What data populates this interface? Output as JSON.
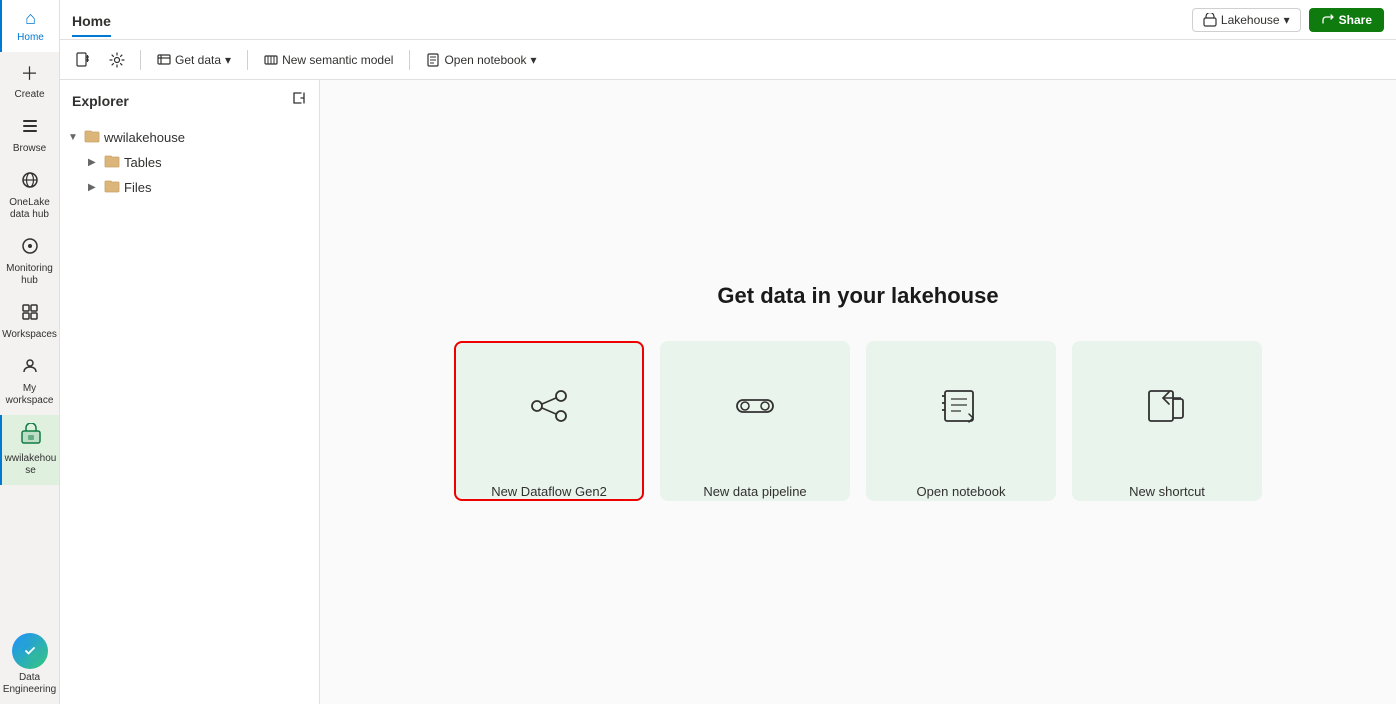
{
  "topbar": {
    "title": "Home",
    "lakehouse_btn": "Lakehouse",
    "share_btn": "Share"
  },
  "toolbar": {
    "new_item_icon": "📄",
    "settings_icon": "⚙",
    "get_data_label": "Get data",
    "new_semantic_model_label": "New semantic model",
    "open_notebook_label": "Open notebook"
  },
  "explorer": {
    "title": "Explorer",
    "root_item": "wwilakehouse",
    "children": [
      {
        "label": "Tables",
        "type": "folder"
      },
      {
        "label": "Files",
        "type": "folder"
      }
    ]
  },
  "sidebar": {
    "items": [
      {
        "id": "home",
        "label": "Home",
        "icon": "🏠",
        "active": true
      },
      {
        "id": "create",
        "label": "Create",
        "icon": "➕"
      },
      {
        "id": "browse",
        "label": "Browse",
        "icon": "📁"
      },
      {
        "id": "onelake",
        "label": "OneLake\ndata hub",
        "icon": "🌐"
      },
      {
        "id": "monitoring",
        "label": "Monitoring\nhub",
        "icon": "⊙"
      },
      {
        "id": "workspaces",
        "label": "Workspaces",
        "icon": "⊞"
      },
      {
        "id": "myworkspace",
        "label": "My\nworkspace",
        "icon": "👤"
      },
      {
        "id": "wwilakehouse",
        "label": "wwilakehou\nse",
        "icon": "💧",
        "highlight": true
      }
    ]
  },
  "main": {
    "heading": "Get data in your lakehouse",
    "cards": [
      {
        "id": "dataflow",
        "label": "New Dataflow Gen2",
        "selected": true
      },
      {
        "id": "pipeline",
        "label": "New data pipeline",
        "selected": false
      },
      {
        "id": "notebook",
        "label": "Open notebook",
        "selected": false
      },
      {
        "id": "shortcut",
        "label": "New shortcut",
        "selected": false
      }
    ]
  },
  "bottom": {
    "label": "Data\nEngineering"
  }
}
